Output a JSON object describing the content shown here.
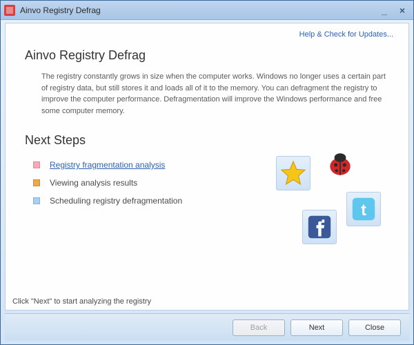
{
  "titlebar": {
    "title": "Ainvo Registry Defrag"
  },
  "updates_link": "Help & Check for Updates...",
  "main_title": "Ainvo Registry Defrag",
  "description": "The registry constantly grows in size when the computer works. Windows no longer uses a certain part of registry data, but still stores it and loads all of it to the memory. You can defragment the registry to improve the computer performance. Defragmentation will improve the Windows performance and free some computer memory.",
  "steps_title": "Next Steps",
  "steps": {
    "analysis": "Registry fragmentation analysis",
    "viewing": "Viewing analysis results",
    "scheduling": "Scheduling registry defragmentation"
  },
  "hint": "Click \"Next\" to start analyzing the registry",
  "buttons": {
    "back": "Back",
    "next": "Next",
    "close": "Close"
  }
}
